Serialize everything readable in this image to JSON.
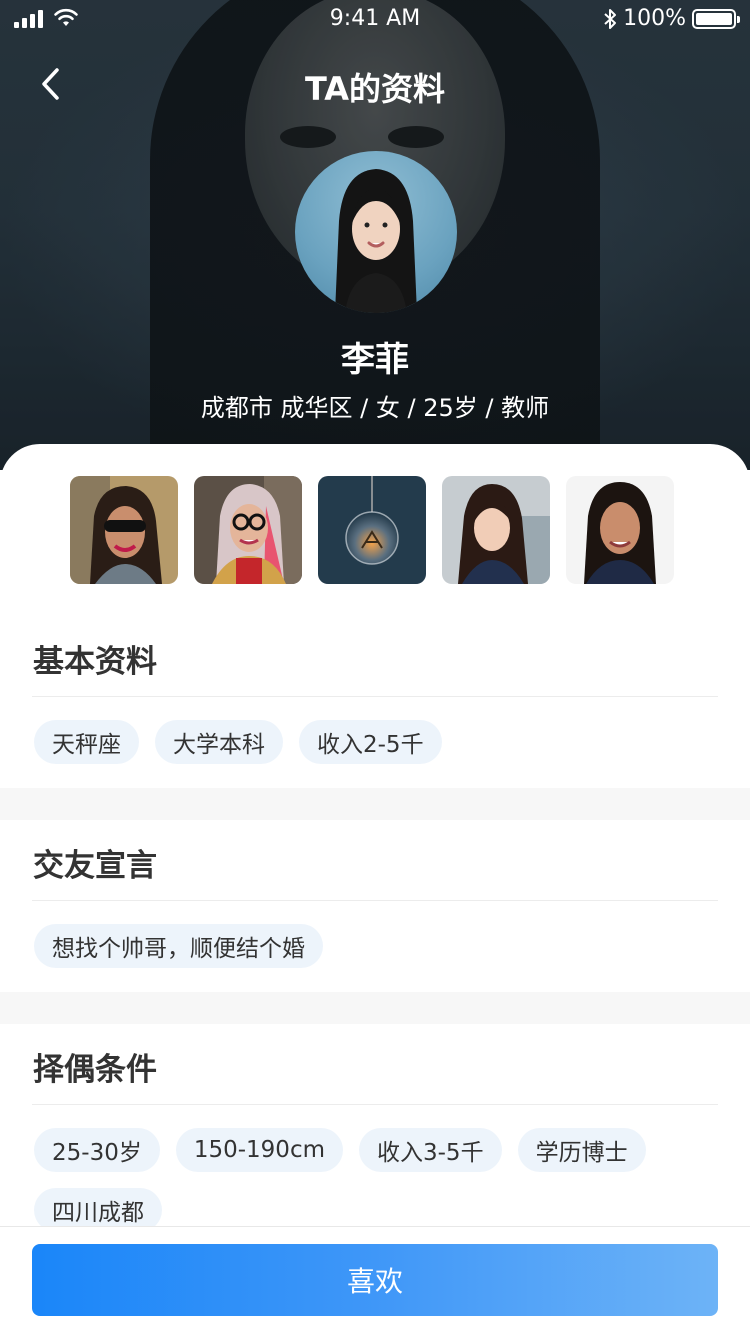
{
  "status_bar": {
    "time": "9:41 AM",
    "battery": "100%"
  },
  "nav": {
    "title": "TA的资料"
  },
  "profile": {
    "name": "李菲",
    "info": "成都市 成华区 / 女 / 25岁 / 教师"
  },
  "gallery": {
    "count": 5
  },
  "sections": {
    "basic": {
      "title": "基本资料",
      "tags": [
        "天秤座",
        "大学本科",
        "收入2-5千"
      ]
    },
    "declaration": {
      "title": "交友宣言",
      "tags": [
        "想找个帅哥，顺便结个婚"
      ]
    },
    "criteria": {
      "title": "择偶条件",
      "tags": [
        "25-30岁",
        "150-190cm",
        "收入3-5千",
        "学历博士",
        "四川成都"
      ]
    }
  },
  "footer": {
    "like_label": "喜欢"
  },
  "colors": {
    "accent_start": "#1a86f9",
    "accent_end": "#6db3f7",
    "tag_bg": "#edf4fb"
  }
}
